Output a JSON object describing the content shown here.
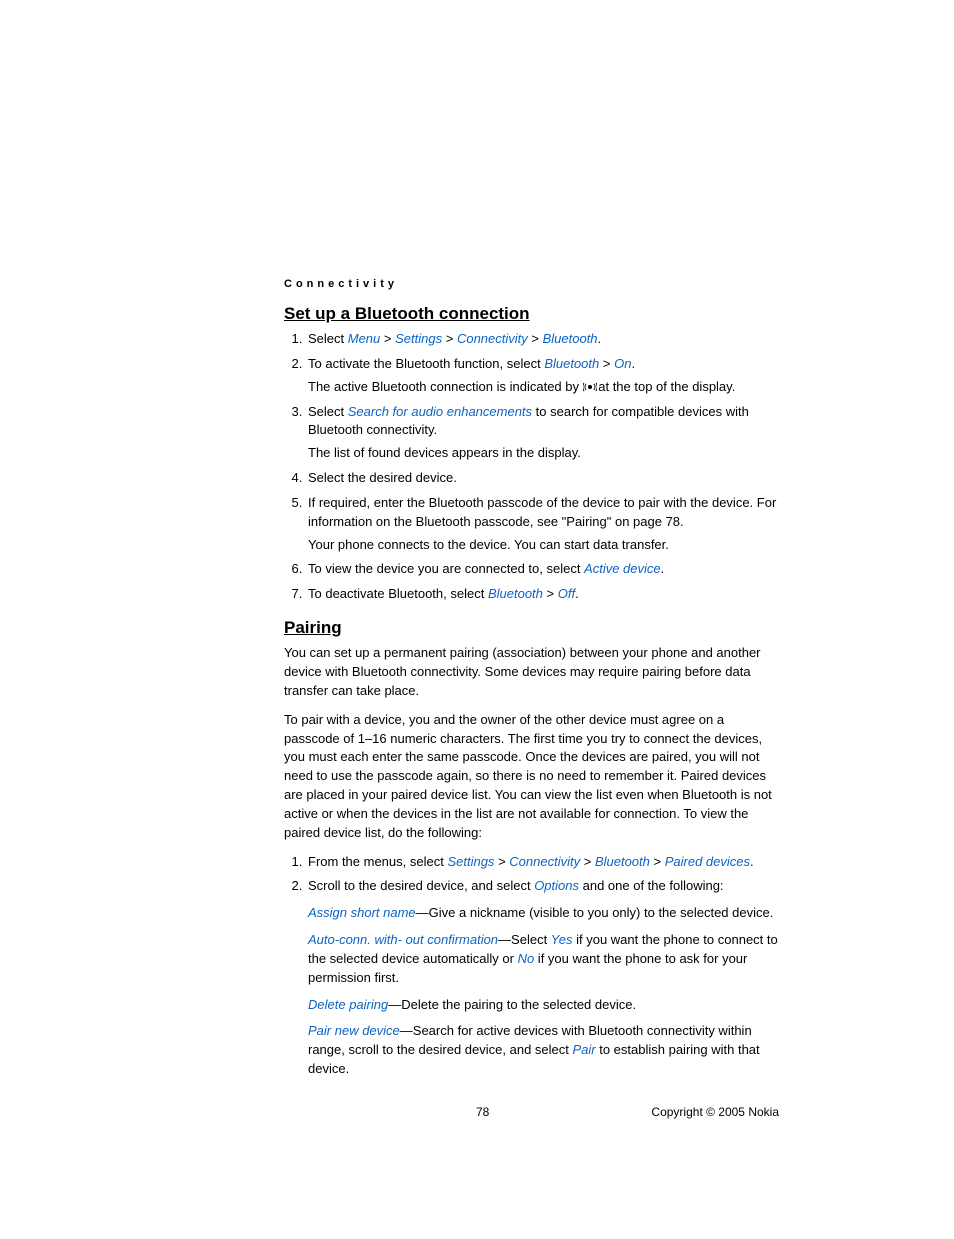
{
  "header": "Connectivity",
  "section1": {
    "title": "Set up a Bluetooth connection",
    "items": [
      {
        "prefix": "Select ",
        "parts": [
          "Menu",
          "Settings",
          "Connectivity",
          "Bluetooth"
        ],
        "suffix": "."
      },
      {
        "line1a": "To activate the Bluetooth function, select ",
        "line1b": "Bluetooth",
        "line1c": "On",
        "line2a": "The active Bluetooth connection is indicated by ",
        "line2b": " at the top of the display."
      },
      {
        "line1a": "Select ",
        "line1b": "Search for audio enhancements",
        "line1c": " to search for compatible devices with Bluetooth connectivity.",
        "line2": "The list of found devices appears in the display."
      },
      {
        "text": "Select the desired device."
      },
      {
        "line1": "If required, enter the Bluetooth passcode of the device to pair with the device. For information on the Bluetooth passcode, see \"Pairing\" on page 78.",
        "line2": "Your phone connects to the device. You can start data transfer."
      },
      {
        "prefix": "To view the device you are connected to, select ",
        "link": "Active device",
        "suffix": "."
      },
      {
        "prefix": "To deactivate Bluetooth, select ",
        "link1": "Bluetooth",
        "link2": "Off",
        "suffix": "."
      }
    ]
  },
  "section2": {
    "title": "Pairing",
    "para1": "You can set up a permanent pairing (association) between your phone and another device with Bluetooth connectivity. Some devices may require pairing before data transfer can take place.",
    "para2": "To pair with a device, you and the owner of the other device must agree on a passcode of 1–16 numeric characters. The first time you try to connect the devices, you must each enter the same passcode. Once the devices are paired, you will not need to use the passcode again, so there is no need to remember it. Paired devices are placed in your paired device list. You can view the list even when Bluetooth is not active or when the devices in the list are not available for connection. To view the paired device list, do the following:",
    "items": [
      {
        "prefix": "From the menus, select ",
        "parts": [
          "Settings",
          "Connectivity",
          "Bluetooth",
          "Paired devices"
        ],
        "suffix": "."
      },
      {
        "prefix": "Scroll to the desired device, and select ",
        "link": "Options",
        "suffix": " and one of the following:",
        "opts": [
          {
            "name": "Assign short name",
            "text": "—Give a nickname (visible to you only) to the selected device."
          },
          {
            "name": "Auto-conn. with- out confirmation",
            "pre": "—Select ",
            "yes": "Yes",
            "mid": " if you want the phone to connect to the selected device automatically or ",
            "no": "No",
            "post": " if you want the phone to ask for your permission first."
          },
          {
            "name": "Delete pairing",
            "text": "—Delete the pairing to the selected device."
          },
          {
            "name": "Pair new device",
            "pre": "—Search for active devices with Bluetooth connectivity within range, scroll to the desired device, and select ",
            "pair": "Pair",
            "post": " to establish pairing with that device."
          }
        ]
      }
    ]
  },
  "footer": {
    "page": "78",
    "copyright": "Copyright © 2005 Nokia"
  }
}
